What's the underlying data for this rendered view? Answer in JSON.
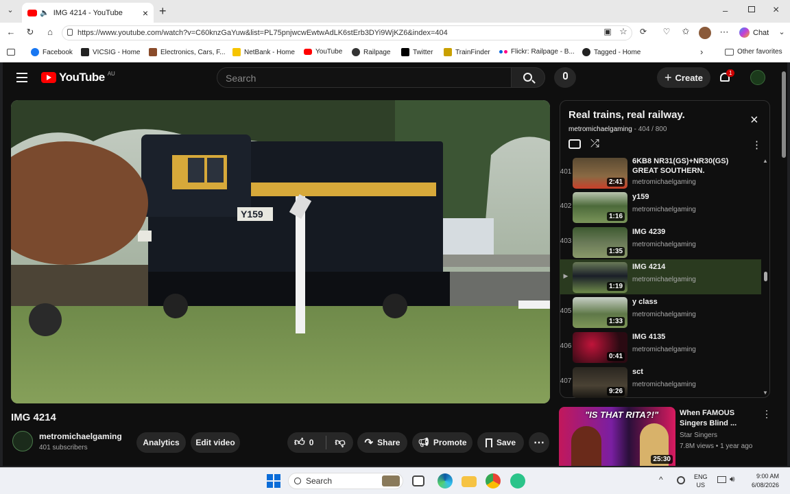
{
  "browser": {
    "tab_title": "IMG 4214 - YouTube",
    "url": "https://www.youtube.com/watch?v=C60knzGaYuw&list=PL75pnjwcwEwtwAdLK6stErb3DYi9WjKZ6&index=404",
    "chat_label": "Chat",
    "favorites": [
      {
        "label": "Facebook",
        "color": "#1877f2"
      },
      {
        "label": "VICSIG - Home",
        "color": "#222222"
      },
      {
        "label": "Electronics, Cars, F...",
        "color": "#8a4b2a"
      },
      {
        "label": "NetBank - Home",
        "color": "#f6c400"
      },
      {
        "label": "YouTube",
        "color": "#ff0000"
      },
      {
        "label": "Railpage",
        "color": "#333333"
      },
      {
        "label": "Twitter",
        "color": "#000000"
      },
      {
        "label": "TrainFinder",
        "color": "#c9a000"
      },
      {
        "label": "Flickr: Railpage - B...",
        "color": "#ff0084"
      },
      {
        "label": "Tagged - Home",
        "color": "#222222"
      }
    ],
    "other_favorites": "Other favorites"
  },
  "youtube": {
    "logo_text": "YouTube",
    "region": "AU",
    "search_placeholder": "Search",
    "create_label": "Create",
    "notif_count": "1",
    "video_title": "IMG 4214",
    "channel_name": "metromichaelgaming",
    "subscribers": "401 subscribers",
    "analytics_label": "Analytics",
    "edit_label": "Edit video",
    "likes": "0",
    "share_label": "Share",
    "promote_label": "Promote",
    "save_label": "Save",
    "loco_number": "Y159"
  },
  "playlist": {
    "title": "Real trains, real railway.",
    "owner": "metromichaelgaming",
    "position": "- 404 / 800",
    "items": [
      {
        "index": "401",
        "title": "6KB8 NR31(GS)+NR30(GS) GREAT SOUTHERN.",
        "channel": "metromichaelgaming",
        "duration": "2:41"
      },
      {
        "index": "402",
        "title": "y159",
        "channel": "metromichaelgaming",
        "duration": "1:16"
      },
      {
        "index": "403",
        "title": "IMG 4239",
        "channel": "metromichaelgaming",
        "duration": "1:35"
      },
      {
        "index": "▶",
        "title": "IMG 4214",
        "channel": "metromichaelgaming",
        "duration": "1:19"
      },
      {
        "index": "405",
        "title": "y class",
        "channel": "metromichaelgaming",
        "duration": "1:33"
      },
      {
        "index": "406",
        "title": "IMG 4135",
        "channel": "metromichaelgaming",
        "duration": "0:41"
      },
      {
        "index": "407",
        "title": "sct",
        "channel": "metromichaelgaming",
        "duration": "9:26"
      }
    ]
  },
  "recommended": {
    "title": "When FAMOUS Singers Blind ...",
    "channel": "Star Singers",
    "meta": "7.8M views • 1 year ago",
    "duration": "25:30",
    "thumb_text": "\"IS THAT RITA?!\""
  },
  "taskbar": {
    "search_label": "Search",
    "lang": "ENG",
    "region": "US",
    "time": "9:00 AM",
    "date": "6/08/2026"
  }
}
